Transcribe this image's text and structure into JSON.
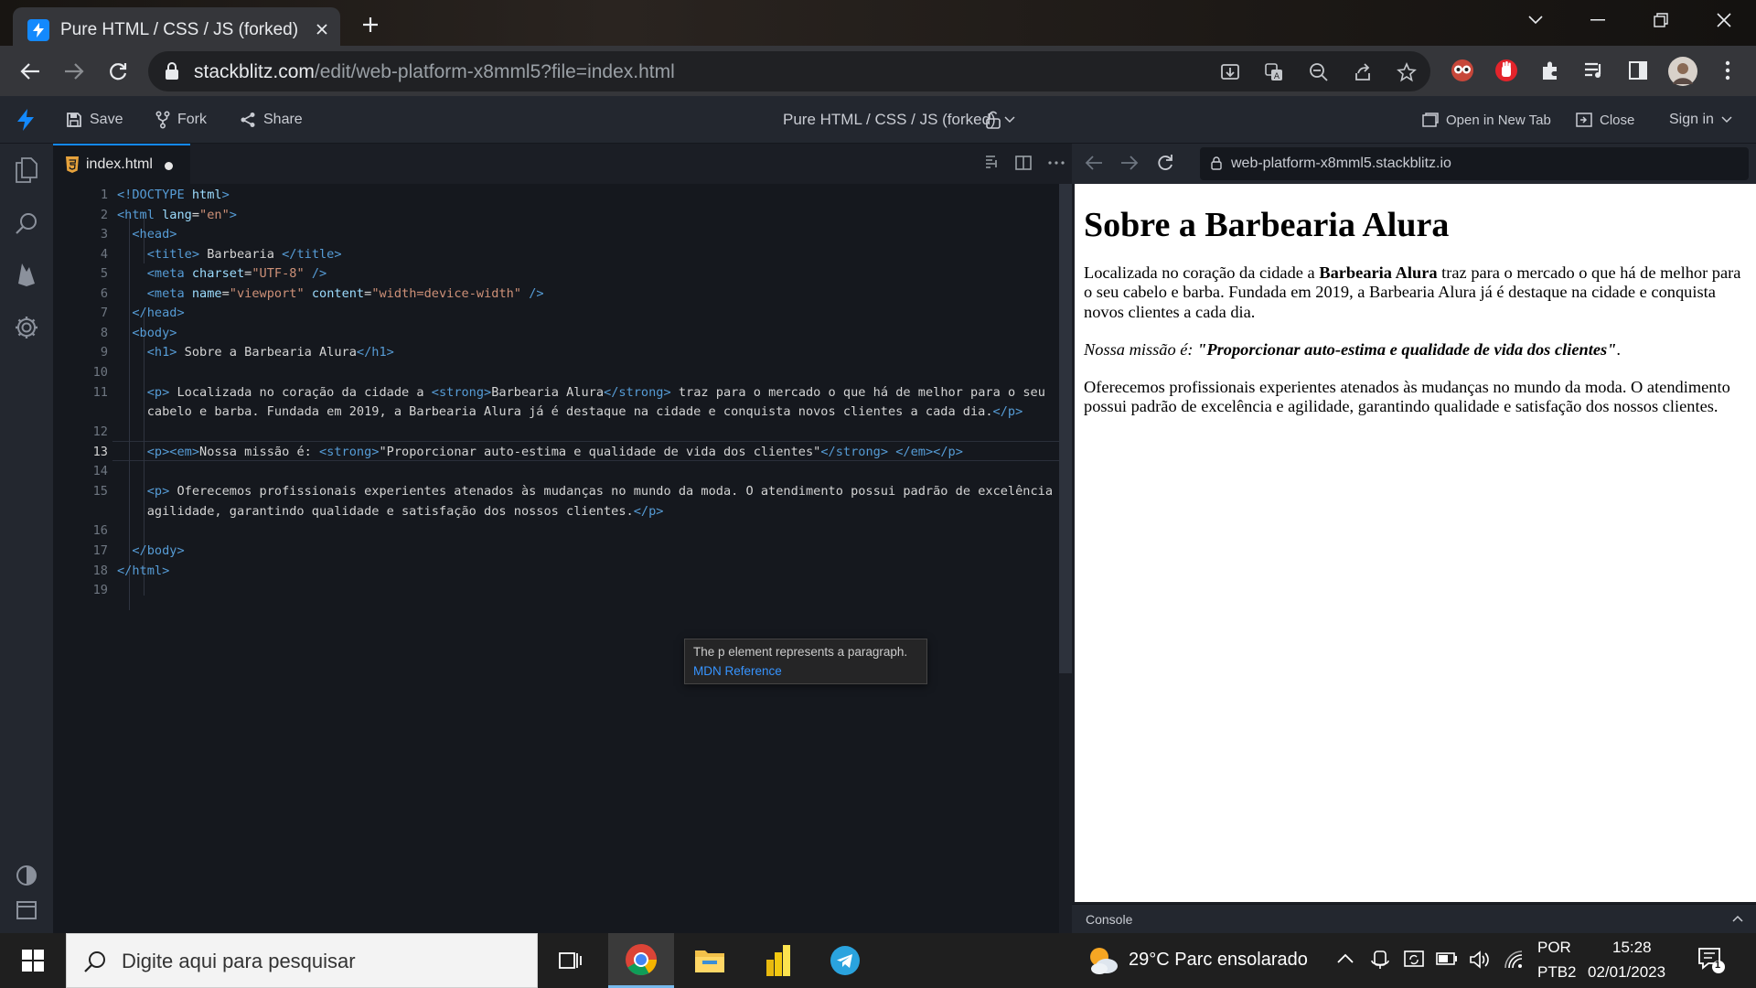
{
  "browser": {
    "tab_title": "Pure HTML / CSS / JS (forked) - S",
    "url_host": "stackblitz.com",
    "url_path": "/edit/web-platform-x8mml5?file=index.html"
  },
  "stackblitz": {
    "header": {
      "save_label": "Save",
      "fork_label": "Fork",
      "share_label": "Share",
      "project_title": "Pure HTML / CSS / JS (forked)",
      "open_new_tab_label": "Open in New Tab",
      "close_label": "Close",
      "sign_in_label": "Sign in"
    },
    "editor": {
      "file_tab": "index.html",
      "line_numbers": [
        "1",
        "2",
        "3",
        "4",
        "5",
        "6",
        "7",
        "8",
        "9",
        "10",
        "11",
        "",
        "12",
        "13",
        "14",
        "15",
        "",
        "16",
        "17",
        "18",
        "19"
      ],
      "current_line": "13",
      "hover": {
        "description": "The p element represents a paragraph.",
        "link": "MDN Reference"
      }
    },
    "preview": {
      "url": "web-platform-x8mml5.stackblitz.io",
      "heading": "Sobre a Barbearia Alura",
      "p1_before": "Localizada no coração da cidade a ",
      "p1_strong": "Barbearia Alura",
      "p1_after": " traz para o mercado o que há de melhor para o seu cabelo e barba. Fundada em 2019, a Barbearia Alura já é destaque na cidade e conquista novos clientes a cada dia.",
      "p2_em": "Nossa missão é: ",
      "p2_strong": "\"Proporcionar auto-estima e qualidade de vida dos clientes\"",
      "p2_end": ".",
      "p3": "Oferecemos profissionais experientes atenados às mudanças no mundo da moda. O atendimento possui padrão de excelência e agilidade, garantindo qualidade e satisfação dos nossos clientes."
    },
    "console_label": "Console"
  },
  "taskbar": {
    "search_placeholder": "Digite aqui para pesquisar",
    "weather": "29°C  Parc ensolarado",
    "lang_1": "POR",
    "lang_2": "PTB2",
    "time": "15:28",
    "date": "02/01/2023",
    "notification_count": "1"
  },
  "colors": {
    "accent": "#1389fd",
    "editor_bg": "#15181e",
    "tag": "#569cd6",
    "attribute": "#9cdcfe",
    "string": "#ce9178"
  }
}
